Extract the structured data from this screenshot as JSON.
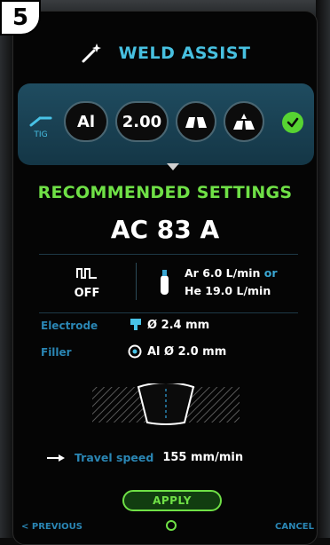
{
  "step_number": "5",
  "header": {
    "title": "WELD ASSIST",
    "icon": "magic-wand-icon"
  },
  "tool_row": {
    "process_label": "TIG",
    "material": "Al",
    "thickness": "2.00",
    "joint_1_icon": "butt-joint-icon",
    "joint_2_icon": "fillet-joint-icon",
    "status_icon": "check-icon"
  },
  "recommended": {
    "title": "RECOMMENDED SETTINGS",
    "current": "AC 83 A"
  },
  "pulse": {
    "icon": "pulse-wave-icon",
    "value": "OFF"
  },
  "gas": {
    "icon": "gas-bottle-icon",
    "line1": "Ar 6.0 L/min",
    "or": "or",
    "line2": "He 19.0 L/min"
  },
  "electrode": {
    "label": "Electrode",
    "value": "Ø 2.4 mm"
  },
  "filler": {
    "label": "Filler",
    "value": "Al Ø 2.0 mm"
  },
  "travel_speed": {
    "label": "Travel speed",
    "value": "155 mm/min"
  },
  "apply_label": "APPLY",
  "footer": {
    "previous": "< PREVIOUS",
    "cancel": "CANCEL"
  },
  "colors": {
    "accent_blue": "#47c0e0",
    "accent_green": "#6fe046",
    "label_blue": "#2a86b4",
    "panel": "#1f4c60"
  }
}
